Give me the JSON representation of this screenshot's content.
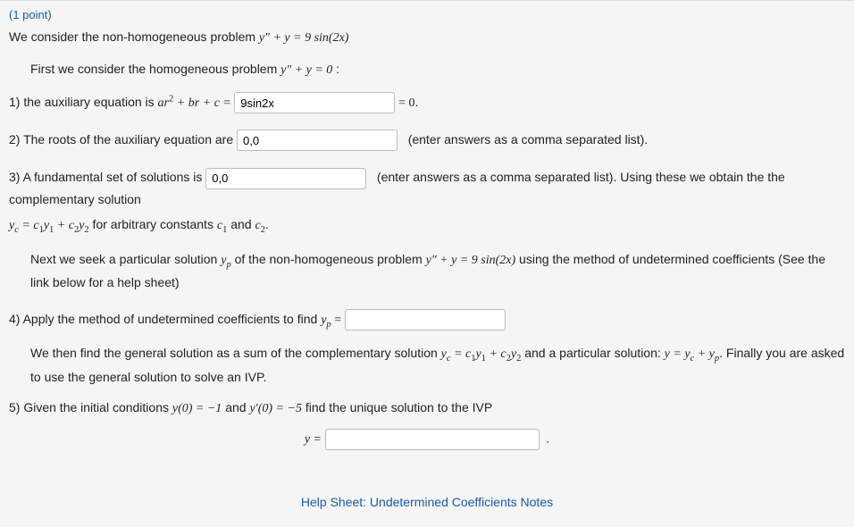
{
  "points": "(1 point)",
  "intro": {
    "prefix": "We consider the non-homogeneous problem ",
    "equation": "y″ + y = 9 sin(2x)"
  },
  "first": {
    "prefix": "First we consider the homogeneous problem ",
    "equation": "y″ + y = 0",
    "suffix": " :"
  },
  "q1": {
    "label": "1) the auxiliary equation is ",
    "lhs": "ar",
    "exp": "2",
    "mid": " + br + c = ",
    "input": "9sin2x",
    "rhs": " = 0"
  },
  "q2": {
    "label": "2) The roots of the auxiliary equation are ",
    "input": "0,0",
    "hint": "(enter answers as a comma separated list)."
  },
  "q3": {
    "label": "3) A fundamental set of solutions is ",
    "input": "0,0",
    "hint": "(enter answers as a comma separated list). Using these we obtain the the complementary solution",
    "line2_a": "y",
    "line2_b": "c",
    "line2_c": " = c",
    "line2_d": "1",
    "line2_e": "y",
    "line2_f": "1",
    "line2_g": " + c",
    "line2_h": "2",
    "line2_i": "y",
    "line2_j": "2",
    "line2_k": " for arbitrary constants ",
    "line2_l": "c",
    "line2_m": "1",
    "line2_n": " and ",
    "line2_o": "c",
    "line2_p": "2",
    "line2_q": "."
  },
  "next": {
    "a": "Next we seek a particular solution ",
    "b": "y",
    "c": "p",
    "d": " of the non-homogeneous problem ",
    "e": "y″ + y = 9 sin(2x)",
    "f": " using the method of undetermined coefficients (See the link below for a help sheet)"
  },
  "q4": {
    "label": "4) Apply the method of undetermined coefficients to find ",
    "yp_a": "y",
    "yp_b": "p",
    "eq": " = ",
    "input": ""
  },
  "gensol": {
    "a": "We then find the general solution as a sum of the complementary solution ",
    "b": "y",
    "c": "c",
    "d": " = c",
    "e": "1",
    "f": "y",
    "g": "1",
    "h": " + c",
    "i": "2",
    "j": "y",
    "k": "2",
    "l": " and a particular solution: ",
    "m": "y = y",
    "n": "c",
    "o": " + y",
    "p": "p",
    "q": ". Finally you are asked to use the general solution to solve an IVP."
  },
  "q5": {
    "a": "5) Given the initial conditions ",
    "b": "y(0) = −1",
    "c": " and ",
    "d": "y′(0) = −5",
    "e": " find the unique solution to the IVP",
    "ylabel": "y = ",
    "input": ""
  },
  "help": "Help Sheet: Undetermined Coefficients Notes"
}
